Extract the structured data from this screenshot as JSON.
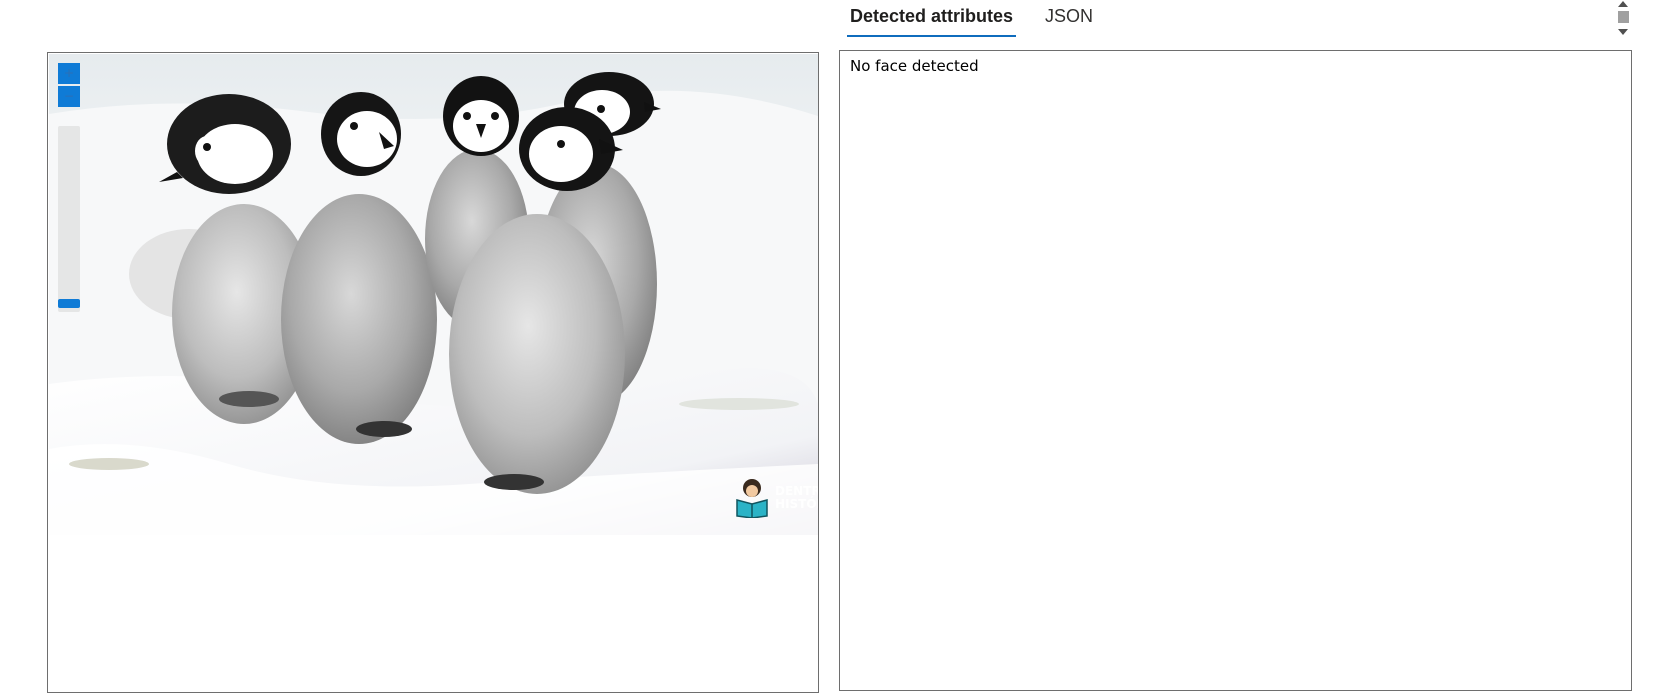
{
  "viewer": {
    "zoom_in_label": "+",
    "zoom_out_label": "−",
    "zoom_level": 0.0,
    "image_alt": "Five emperor penguin chicks standing in snow",
    "watermark_text": "DENTRO DA\nHISTÓRIA"
  },
  "tabs": [
    {
      "label": "Detected attributes",
      "active": true
    },
    {
      "label": "JSON",
      "active": false
    }
  ],
  "result": {
    "message": "No face detected"
  },
  "colors": {
    "accent": "#0f7bd6",
    "tab_underline": "#0f6cbd",
    "border": "#6e6e6e"
  }
}
